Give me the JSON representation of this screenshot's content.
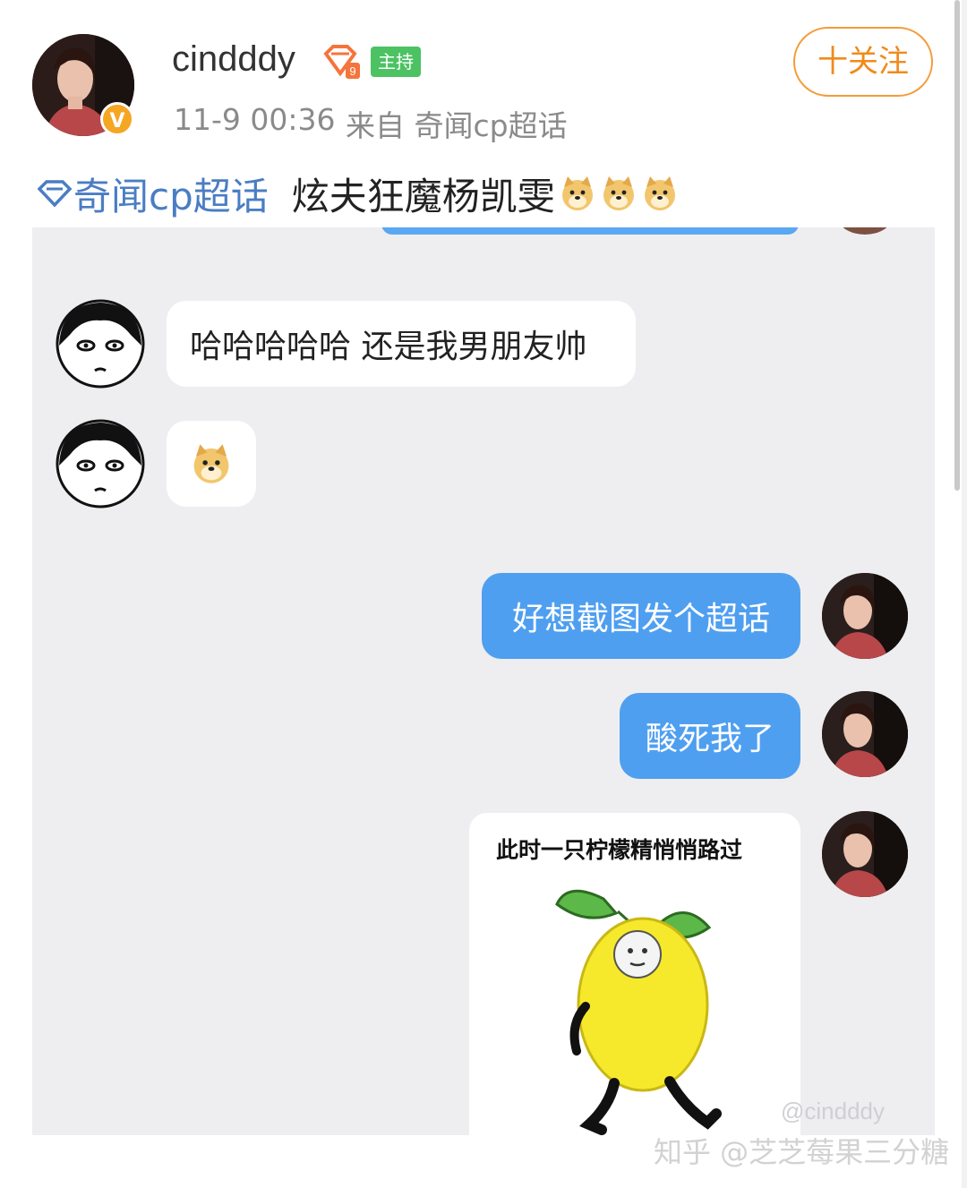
{
  "post": {
    "username": "cindddy",
    "host_badge": "主持",
    "verified_mark": "V",
    "time": "11-9 00:36",
    "source": "来自 奇闻cp超话",
    "follow_label": "十关注",
    "topic_tag": "奇闻cp超话",
    "text": "炫夫狂魔杨凯雯",
    "emoji": [
      "doge-emoji",
      "doge-emoji",
      "doge-emoji"
    ],
    "accent_color": "#f08a1c",
    "link_color": "#4a7dc4"
  },
  "chat": {
    "messages": [
      {
        "side": "left",
        "type": "text",
        "text": "哈哈哈哈哈 还是我男朋友帅"
      },
      {
        "side": "left",
        "type": "emoji",
        "icon": "doge-emoji"
      },
      {
        "side": "right",
        "type": "text",
        "text": "好想截图发个超话"
      },
      {
        "side": "right",
        "type": "text",
        "text": "酸死我了"
      },
      {
        "side": "right",
        "type": "sticker",
        "caption": "此时一只柠檬精悄悄路过",
        "icon": "lemon-sticker"
      }
    ],
    "bubble_color_sent": "#4f9ff0",
    "bubble_color_received": "#ffffff"
  },
  "watermarks": {
    "weibo": "@cindddy",
    "zhihu": "知乎 @芝芝莓果三分糖"
  }
}
